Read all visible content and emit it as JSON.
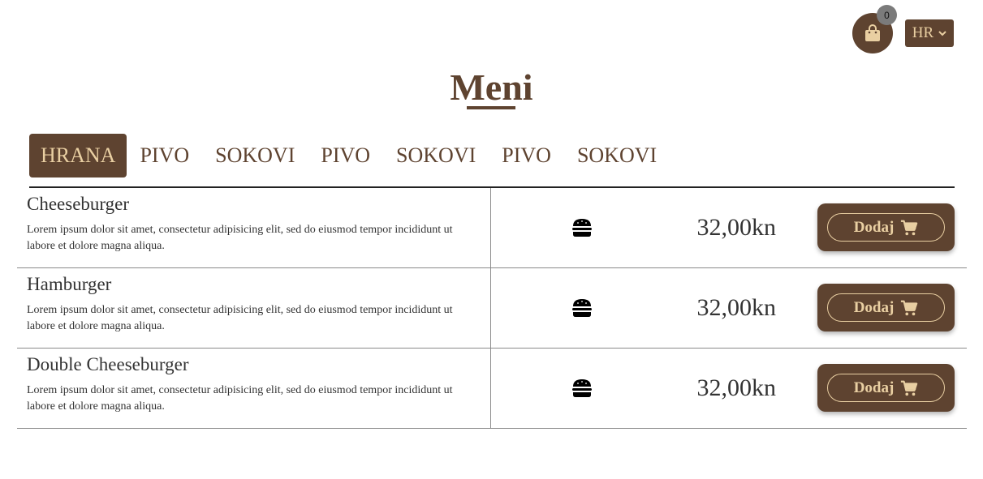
{
  "header": {
    "cart_count": "0",
    "language": "HR",
    "cart_icon": "shopping-bag-icon",
    "language_chevron_icon": "chevron-down-icon"
  },
  "page": {
    "title": "Meni"
  },
  "tabs": [
    {
      "label": "HRANA",
      "active": true
    },
    {
      "label": "PIVO",
      "active": false
    },
    {
      "label": "SOKOVI",
      "active": false
    },
    {
      "label": "PIVO",
      "active": false
    },
    {
      "label": "SOKOVI",
      "active": false
    },
    {
      "label": "PIVO",
      "active": false
    },
    {
      "label": "SOKOVI",
      "active": false
    }
  ],
  "items": [
    {
      "name": "Cheeseburger",
      "description": "Lorem ipsum dolor sit amet, consectetur adipisicing elit, sed do eiusmod tempor incididunt ut labore et dolore magna aliqua.",
      "icon": "burger-icon",
      "price": "32,00kn",
      "add_label": "Dodaj"
    },
    {
      "name": "Hamburger",
      "description": "Lorem ipsum dolor sit amet, consectetur adipisicing elit, sed do eiusmod tempor incididunt ut labore et dolore magna aliqua.",
      "icon": "burger-icon",
      "price": "32,00kn",
      "add_label": "Dodaj"
    },
    {
      "name": "Double Cheeseburger",
      "description": "Lorem ipsum dolor sit amet, consectetur adipisicing elit, sed do eiusmod tempor incididunt ut labore et dolore magna aliqua.",
      "icon": "burger-icon",
      "price": "32,00kn",
      "add_label": "Dodaj"
    }
  ],
  "colors": {
    "brand_brown": "#5e4330",
    "accent_cream": "#e9cfa2",
    "badge_gray": "#7b7b7b"
  }
}
